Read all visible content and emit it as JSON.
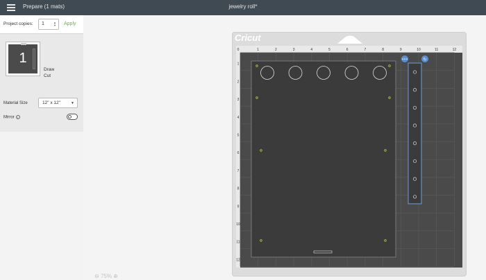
{
  "topbar": {
    "menu_icon": "hamburger-icon",
    "left_title": "Prepare (1 mats)",
    "doc_title": "jewelry roll*"
  },
  "sidebar": {
    "copies_label": "Project copies:",
    "copies_value": "1",
    "apply_label": "Apply",
    "mat": {
      "number": "1",
      "draw_label": "Draw",
      "cut_label": "Cut"
    },
    "material_size_label": "Material Size",
    "material_size_value": "12\" x 12\"",
    "mirror_label": "Mirror",
    "mirror_on": false
  },
  "canvas": {
    "logo_text": "Cricut",
    "zoom_text": "75%",
    "ruler_top": [
      "0",
      "1",
      "2",
      "3",
      "4",
      "5",
      "6",
      "7",
      "8",
      "9",
      "10",
      "11",
      "12"
    ],
    "ruler_left": [
      "1",
      "2",
      "3",
      "4",
      "5",
      "6",
      "7",
      "8",
      "9",
      "10",
      "11",
      "12"
    ],
    "colors": {
      "mat": "#4a4a4a",
      "grid": "#5a5a5a",
      "piece": "#3b3b3b",
      "selection": "#6f9fd8",
      "dot": "#b7c43a"
    }
  }
}
